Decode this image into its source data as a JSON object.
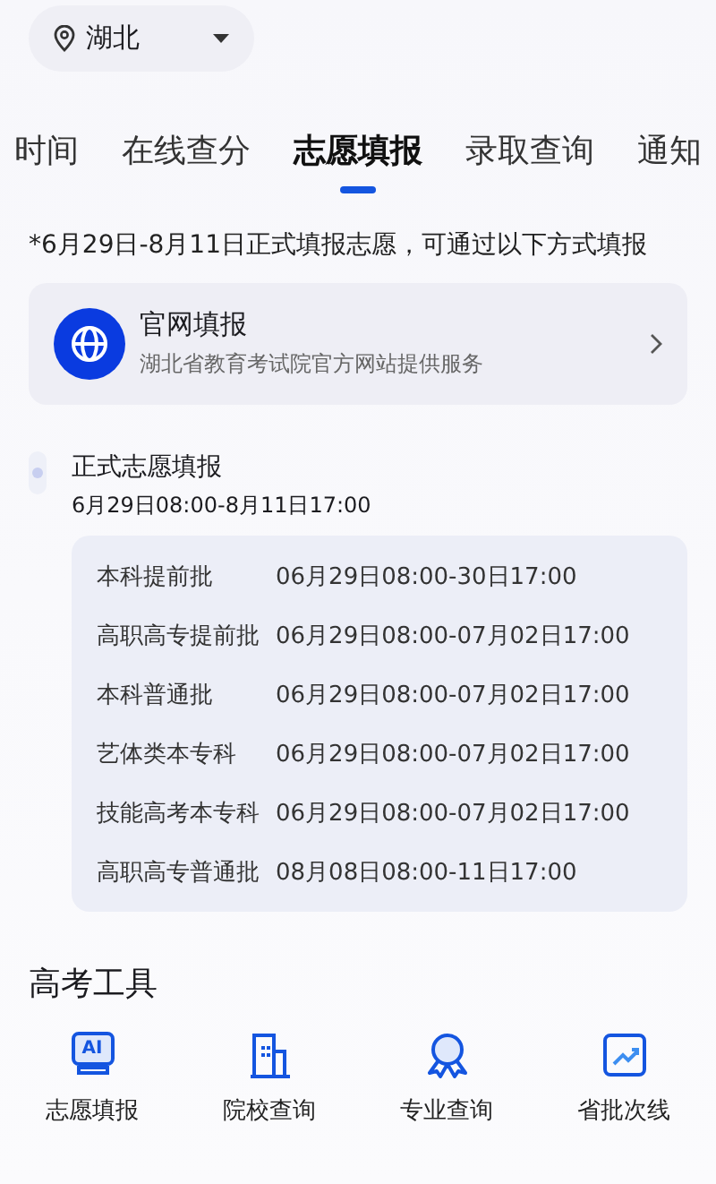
{
  "location": {
    "label": "湖北"
  },
  "tabs": [
    {
      "label": "时间",
      "selected": false
    },
    {
      "label": "在线查分",
      "selected": false
    },
    {
      "label": "志愿填报",
      "selected": true
    },
    {
      "label": "录取查询",
      "selected": false
    },
    {
      "label": "通知",
      "selected": false
    }
  ],
  "notice": "*6月29日-8月11日正式填报志愿，可通过以下方式填报",
  "official_card": {
    "title": "官网填报",
    "subtitle": "湖北省教育考试院官方网站提供服务"
  },
  "timeline": {
    "title": "正式志愿填报",
    "period": "6月29日08:00-8月11日17:00",
    "rows": [
      {
        "batch": "本科提前批",
        "time": "06月29日08:00-30日17:00"
      },
      {
        "batch": "高职高专提前批",
        "time": "06月29日08:00-07月02日17:00"
      },
      {
        "batch": "本科普通批",
        "time": "06月29日08:00-07月02日17:00"
      },
      {
        "batch": "艺体类本专科",
        "time": "06月29日08:00-07月02日17:00"
      },
      {
        "batch": "技能高考本专科",
        "time": "06月29日08:00-07月02日17:00"
      },
      {
        "batch": "高职高专普通批",
        "time": "08月08日08:00-11日17:00"
      }
    ]
  },
  "tools": {
    "title": "高考工具",
    "items": [
      {
        "kind": "ai",
        "icon_text": "AI",
        "label": "志愿填报"
      },
      {
        "kind": "building",
        "label": "院校查询"
      },
      {
        "kind": "medal",
        "label": "专业查询"
      },
      {
        "kind": "chart",
        "label": "省批次线"
      }
    ]
  }
}
